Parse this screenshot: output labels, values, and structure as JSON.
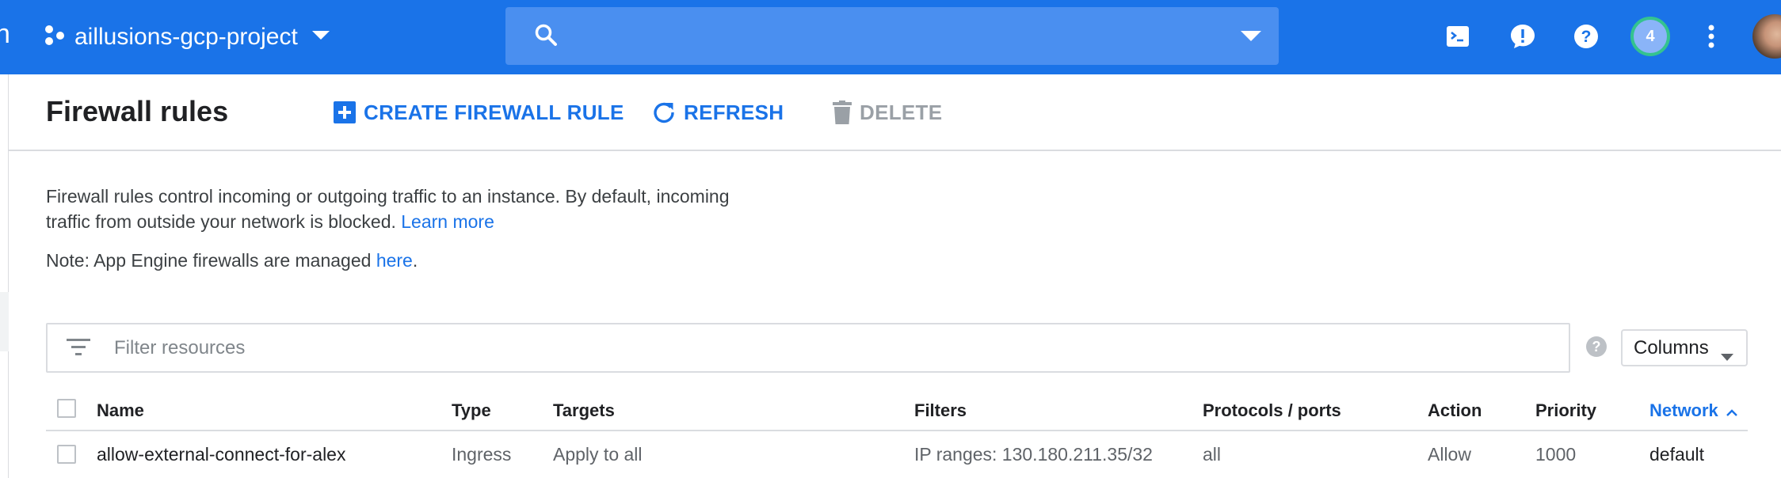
{
  "topbar": {
    "cutoff_letter": "n",
    "project_name": "aillusions-gcp-project",
    "search_placeholder": "",
    "notification_count": "4",
    "icons": [
      "cloud-shell-icon",
      "feedback-icon",
      "help-icon",
      "more-vert-icon"
    ]
  },
  "toolbar": {
    "title": "Firewall rules",
    "create_label": "CREATE FIREWALL RULE",
    "refresh_label": "REFRESH",
    "delete_label": "DELETE"
  },
  "description": {
    "text": "Firewall rules control incoming or outgoing traffic to an instance. By default, incoming traffic from outside your network is blocked.",
    "learn_more": "Learn more",
    "note_prefix": "Note: App Engine firewalls are managed",
    "note_link": "here",
    "note_suffix": "."
  },
  "filter": {
    "placeholder": "Filter resources",
    "columns_label": "Columns",
    "help_glyph": "?"
  },
  "table": {
    "headers": {
      "name": "Name",
      "type": "Type",
      "targets": "Targets",
      "filters": "Filters",
      "protocols": "Protocols / ports",
      "action": "Action",
      "priority": "Priority",
      "network": "Network"
    },
    "sorted_column": "network",
    "sort_direction": "ascending",
    "rows": [
      {
        "name": "allow-external-connect-for-alex",
        "type": "Ingress",
        "targets": "Apply to all",
        "filters": "IP ranges: 130.180.211.35/32",
        "protocols": "all",
        "action": "Allow",
        "priority": "1000",
        "network": "default"
      }
    ]
  },
  "colors": {
    "topbar": "#1a73e8",
    "search_bg": "#4a8ff0",
    "link": "#1a73e8",
    "disabled": "#9aa0a6",
    "badge_ring": "#34c38f"
  }
}
